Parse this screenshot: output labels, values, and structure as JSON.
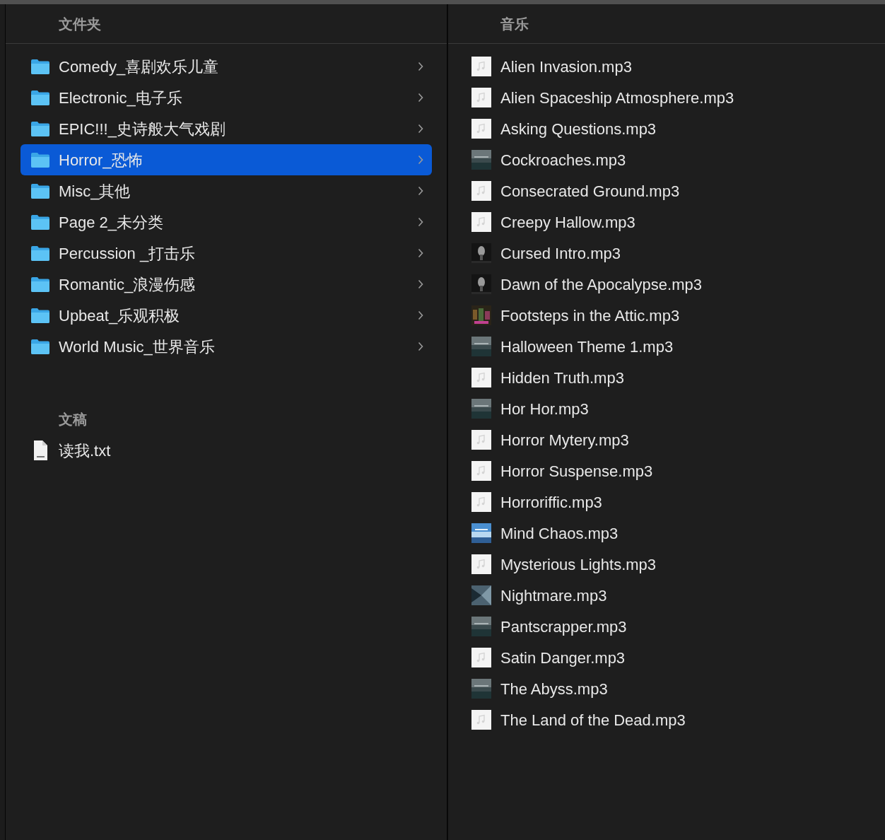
{
  "folders_pane": {
    "header": "文件夹",
    "folders": [
      {
        "name": "Comedy_喜剧欢乐儿童",
        "selected": false
      },
      {
        "name": "Electronic_电子乐",
        "selected": false
      },
      {
        "name": "EPIC!!!_史诗般大气戏剧",
        "selected": false
      },
      {
        "name": "Horror_恐怖",
        "selected": true
      },
      {
        "name": "Misc_其他",
        "selected": false
      },
      {
        "name": "Page 2_未分类",
        "selected": false
      },
      {
        "name": "Percussion _打击乐",
        "selected": false
      },
      {
        "name": "Romantic_浪漫伤感",
        "selected": false
      },
      {
        "name": "Upbeat_乐观积极",
        "selected": false
      },
      {
        "name": "World Music_世界音乐",
        "selected": false
      }
    ],
    "documents_header": "文稿",
    "documents": [
      {
        "name": "读我.txt",
        "selected": false
      }
    ]
  },
  "music_pane": {
    "header": "音乐",
    "files": [
      {
        "name": "Alien Invasion.mp3",
        "kind": "note"
      },
      {
        "name": "Alien Spaceship Atmosphere.mp3",
        "kind": "note"
      },
      {
        "name": "Asking Questions.mp3",
        "kind": "note"
      },
      {
        "name": "Cockroaches.mp3",
        "kind": "slate"
      },
      {
        "name": "Consecrated Ground.mp3",
        "kind": "note"
      },
      {
        "name": "Creepy Hallow.mp3",
        "kind": "note"
      },
      {
        "name": "Cursed Intro.mp3",
        "kind": "ghost"
      },
      {
        "name": "Dawn of the Apocalypse.mp3",
        "kind": "ghost"
      },
      {
        "name": "Footsteps in the Attic.mp3",
        "kind": "crowd"
      },
      {
        "name": "Halloween Theme 1.mp3",
        "kind": "slate"
      },
      {
        "name": "Hidden Truth.mp3",
        "kind": "note"
      },
      {
        "name": "Hor Hor.mp3",
        "kind": "slate"
      },
      {
        "name": "Horror Mytery.mp3",
        "kind": "note"
      },
      {
        "name": "Horror Suspense.mp3",
        "kind": "note"
      },
      {
        "name": "Horroriffic.mp3",
        "kind": "note"
      },
      {
        "name": "Mind Chaos.mp3",
        "kind": "sky"
      },
      {
        "name": "Mysterious Lights.mp3",
        "kind": "note"
      },
      {
        "name": "Nightmare.mp3",
        "kind": "wedge"
      },
      {
        "name": "Pantscrapper.mp3",
        "kind": "slate"
      },
      {
        "name": "Satin Danger.mp3",
        "kind": "note"
      },
      {
        "name": "The Abyss.mp3",
        "kind": "slate"
      },
      {
        "name": "The Land of the Dead.mp3",
        "kind": "note"
      }
    ]
  }
}
